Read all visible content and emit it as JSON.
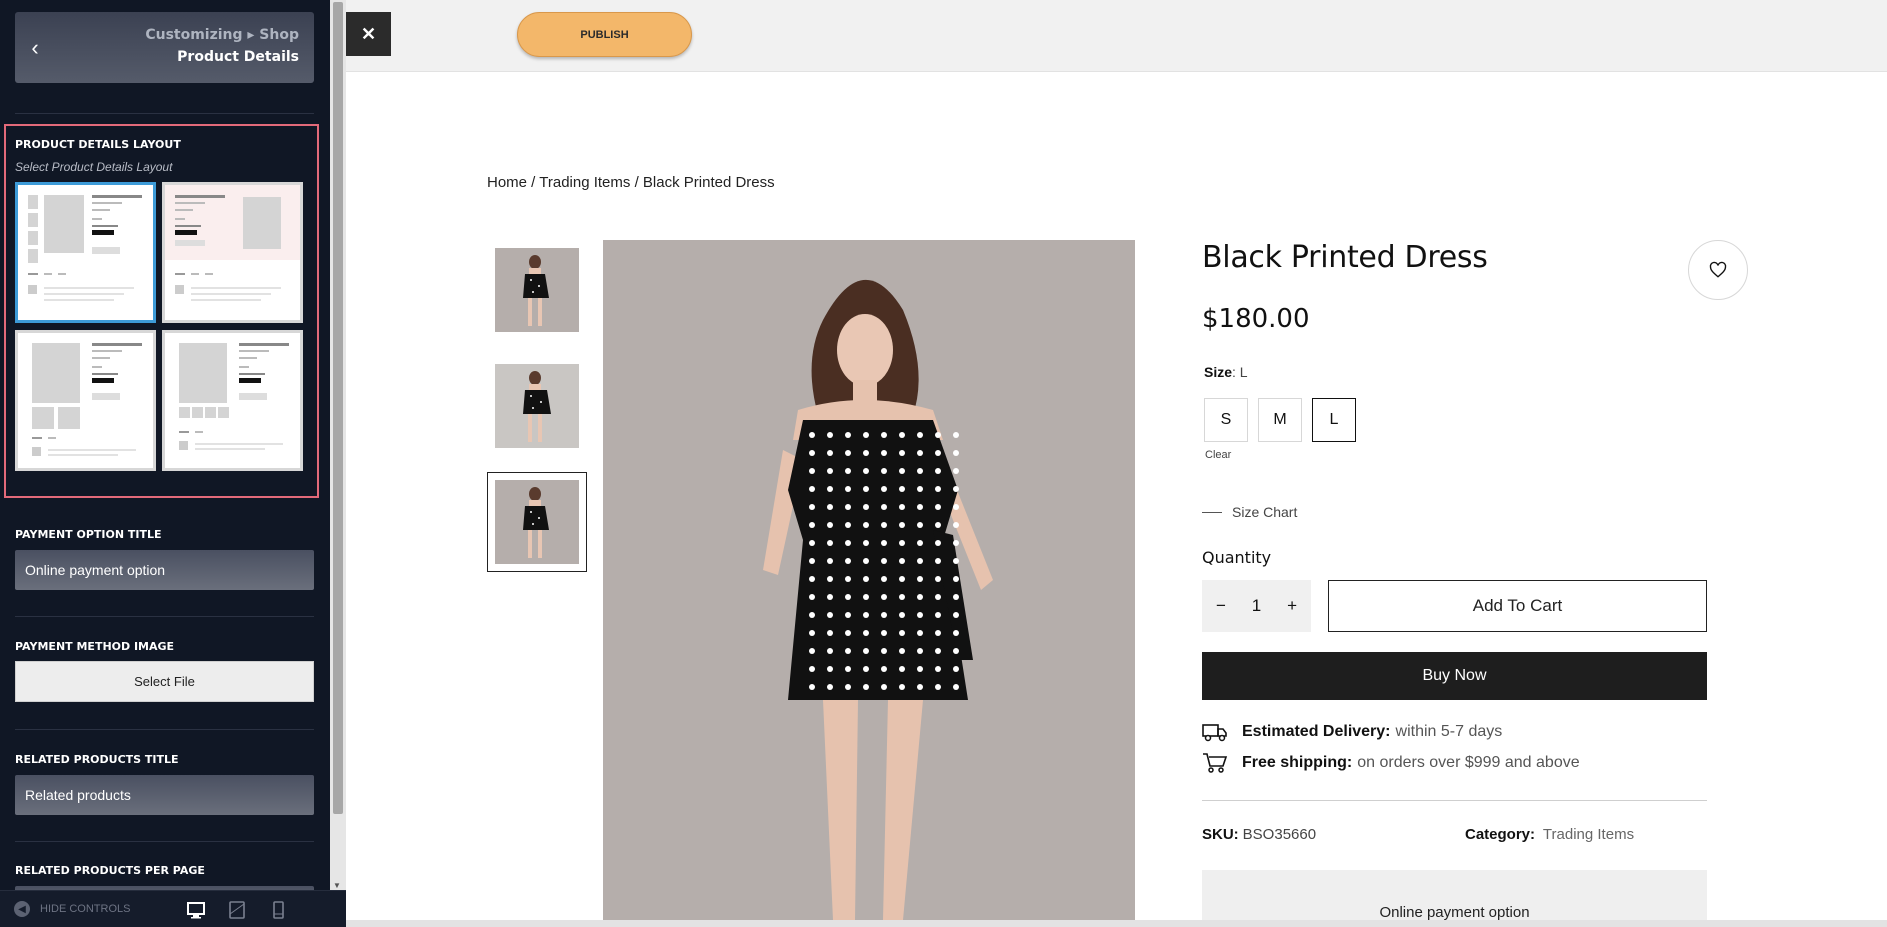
{
  "sidebar": {
    "breadcrumb_parent": "Customizing ▸ Shop",
    "section_title": "Product Details",
    "back_icon": "chevron-left-icon",
    "layout": {
      "label": "PRODUCT DETAILS LAYOUT",
      "sublabel": "Select Product Details Layout",
      "selected_index": 0
    },
    "payment_option_title": {
      "label": "PAYMENT OPTION TITLE",
      "value": "Online payment option"
    },
    "payment_method_image": {
      "label": "PAYMENT METHOD IMAGE",
      "button": "Select File"
    },
    "related_products_title": {
      "label": "RELATED PRODUCTS TITLE",
      "value": "Related products"
    },
    "related_products_per_page": {
      "label": "RELATED PRODUCTS PER PAGE"
    },
    "footer": {
      "hide_controls": "HIDE CONTROLS",
      "devices": [
        "desktop-icon",
        "tablet-icon",
        "mobile-icon"
      ],
      "active_device": "desktop"
    }
  },
  "topbar": {
    "close": "✕",
    "publish": "PUBLISH"
  },
  "product": {
    "breadcrumb": [
      "Home",
      "Trading Items",
      "Black Printed Dress"
    ],
    "breadcrumb_sep": " / ",
    "title": "Black Printed Dress",
    "price": "$180.00",
    "size_label": "Size",
    "size_value": ": L",
    "sizes": [
      "S",
      "M",
      "L"
    ],
    "selected_size": "L",
    "clear": "Clear",
    "size_chart": "Size Chart",
    "quantity_label": "Quantity",
    "quantity": "1",
    "qty_minus": "−",
    "qty_plus": "+",
    "add_to_cart": "Add To Cart",
    "buy_now": "Buy Now",
    "delivery_label": "Estimated Delivery:",
    "delivery_value": "within 5-7 days",
    "shipping_label": "Free shipping:",
    "shipping_value": "on orders over $999 and above",
    "sku_label": "SKU:",
    "sku_value": "BSO35660",
    "category_label": "Category:",
    "category_value": "Trading Items",
    "payment_option": "Online payment option",
    "active_thumbnail": 2
  },
  "colors": {
    "sidebar_bg": "#101725",
    "publish_bg": "#f3b76a",
    "buy_now_bg": "#1e1e1e",
    "photo_bg": "#b5aeab",
    "layout_highlight": "#e26a7a",
    "selected_layout": "#3d9bd8"
  }
}
